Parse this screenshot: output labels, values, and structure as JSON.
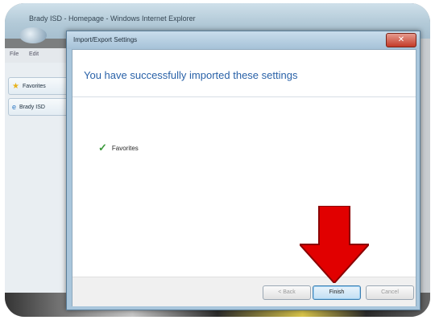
{
  "browser": {
    "title": "Brady ISD - Homepage - Windows Internet Explorer",
    "menu": [
      "File",
      "Edit"
    ],
    "favorites_label": "Favorites",
    "tab_label": "Brady ISD"
  },
  "dialog": {
    "title": "Import/Export Settings",
    "heading": "You have successfully imported these settings",
    "items": [
      {
        "label": "Favorites",
        "status": "check"
      }
    ],
    "buttons": {
      "back": "< Back",
      "finish": "Finish",
      "cancel": "Cancel"
    }
  },
  "colors": {
    "heading": "#2a62a8",
    "close": "#c43b28",
    "annotation_arrow": "#e10000"
  }
}
